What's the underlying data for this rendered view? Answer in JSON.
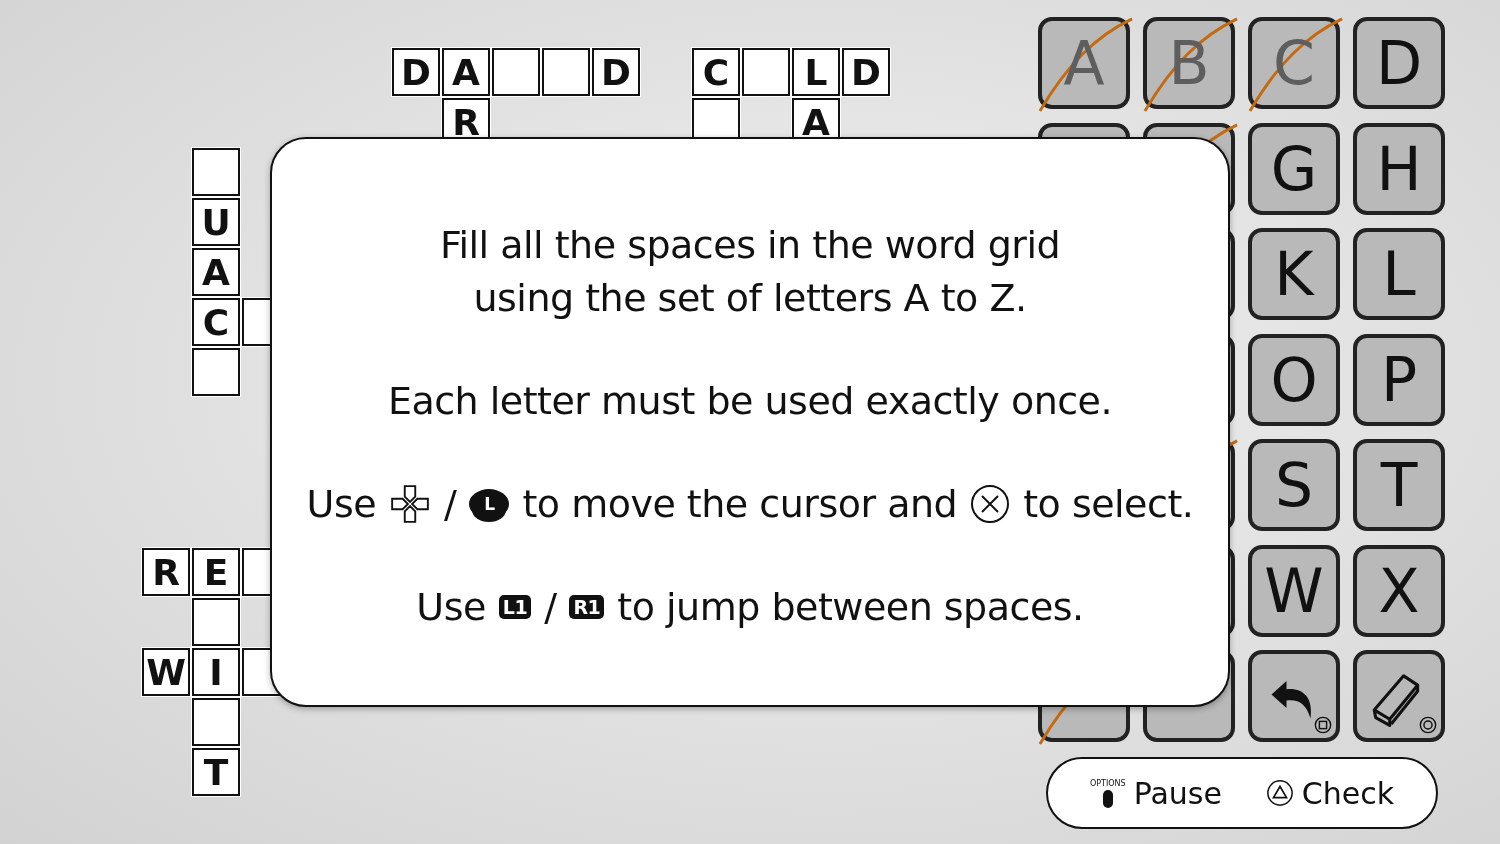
{
  "crossword": {
    "cells": [
      {
        "kind": "letter",
        "letter": "D"
      },
      {
        "kind": "letter",
        "letter": "A"
      },
      {
        "kind": "empty"
      },
      {
        "kind": "empty"
      },
      {
        "kind": "letter",
        "letter": "D"
      },
      {
        "kind": "letter",
        "letter": "R"
      },
      {
        "kind": "letter",
        "letter": "C"
      },
      {
        "kind": "empty"
      },
      {
        "kind": "letter",
        "letter": "L"
      },
      {
        "kind": "letter",
        "letter": "D"
      },
      {
        "kind": "empty"
      },
      {
        "kind": "letter",
        "letter": "A"
      },
      {
        "kind": "empty"
      },
      {
        "kind": "letter",
        "letter": "U"
      },
      {
        "kind": "letter",
        "letter": "A"
      },
      {
        "kind": "letter",
        "letter": "C"
      },
      {
        "kind": "covered"
      },
      {
        "kind": "empty"
      },
      {
        "kind": "letter",
        "letter": "R"
      },
      {
        "kind": "letter",
        "letter": "E"
      },
      {
        "kind": "empty"
      },
      {
        "kind": "empty"
      },
      {
        "kind": "letter",
        "letter": "W"
      },
      {
        "kind": "letter",
        "letter": "I"
      },
      {
        "kind": "covered"
      },
      {
        "kind": "empty"
      },
      {
        "kind": "letter",
        "letter": "T"
      }
    ]
  },
  "keypad": {
    "keys": [
      {
        "kind": "letter",
        "letter": "A",
        "used": true
      },
      {
        "kind": "letter",
        "letter": "B",
        "used": true
      },
      {
        "kind": "letter",
        "letter": "C",
        "used": true
      },
      {
        "kind": "letter",
        "letter": "D",
        "used": false
      },
      {
        "kind": "covered"
      },
      {
        "kind": "covered",
        "used": true
      },
      {
        "kind": "letter",
        "letter": "G",
        "used": false
      },
      {
        "kind": "letter",
        "letter": "H",
        "used": false
      },
      {
        "kind": "covered"
      },
      {
        "kind": "letter",
        "letter": "K",
        "used": false
      },
      {
        "kind": "letter",
        "letter": "L",
        "used": false
      },
      {
        "kind": "covered"
      },
      {
        "kind": "letter",
        "letter": "O",
        "used": false
      },
      {
        "kind": "letter",
        "letter": "P",
        "used": false
      },
      {
        "kind": "covered",
        "used": true
      },
      {
        "kind": "letter",
        "letter": "S",
        "used": false
      },
      {
        "kind": "letter",
        "letter": "T",
        "used": false
      },
      {
        "kind": "covered"
      },
      {
        "kind": "letter",
        "letter": "W",
        "used": false
      },
      {
        "kind": "letter",
        "letter": "X",
        "used": false
      },
      {
        "kind": "covered",
        "used": true
      },
      {
        "kind": "covered"
      },
      {
        "kind": "undo",
        "used": false
      },
      {
        "kind": "erase",
        "used": false
      }
    ]
  },
  "dialog": {
    "paragraphs": [
      {
        "kind": "text",
        "lines": [
          "Fill all the spaces in the word grid",
          "using the set of letters A to Z."
        ]
      },
      {
        "kind": "text",
        "lines": [
          "Each letter must be used exactly once."
        ]
      },
      {
        "kind": "controls",
        "parts": [
          {
            "kind": "text",
            "text": "Use"
          },
          {
            "kind": "dpad"
          },
          {
            "kind": "text",
            "text": "/"
          },
          {
            "kind": "stick",
            "text": "L"
          },
          {
            "kind": "text",
            "text": "to move the cursor and"
          },
          {
            "kind": "cross"
          },
          {
            "kind": "text",
            "text": "to select."
          }
        ]
      },
      {
        "kind": "controls",
        "parts": [
          {
            "kind": "text",
            "text": "Use"
          },
          {
            "kind": "shoulder",
            "text": "L1"
          },
          {
            "kind": "text",
            "text": "/"
          },
          {
            "kind": "shoulder",
            "text": "R1"
          },
          {
            "kind": "text",
            "text": "to jump between spaces."
          }
        ]
      }
    ]
  },
  "action_bar": {
    "pause": {
      "button_label": "OPTIONS",
      "label": "Pause"
    },
    "check": {
      "label": "Check"
    }
  }
}
